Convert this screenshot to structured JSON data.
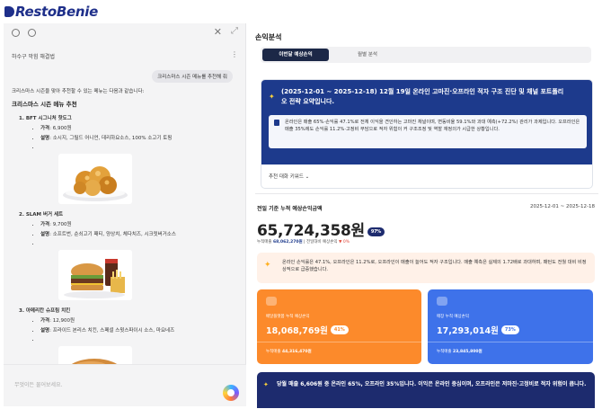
{
  "app": {
    "brand": "RestoBenie"
  },
  "chat": {
    "session_title": "하수구 막힘 해결법",
    "user_message": "크리스마스 시즌 메뉴를 추천해 줘",
    "intro": "크리스마스 시즌을 맞아 추천할 수 있는 메뉴는 다음과 같습니다:",
    "heading": "크리스마스 시즌 메뉴 추천",
    "price_label": "가격",
    "desc_label": "설명",
    "items": [
      {
        "title": "1. BFT 시그니처 핫도그",
        "price": "6,900원",
        "desc": "소시지, 그릴드 어니언, 데리하요소스, 100% 소고기 토핑",
        "image": "fried-chicken-image"
      },
      {
        "title": "2. SLAM 버거 세트",
        "price": "9,700원",
        "desc": "소프트번, 순쇠고기 패티, 양상치, 체다치즈, 시크릿버거소스",
        "image": "burger-set-image"
      },
      {
        "title": "3. 아메리칸 슈프림 치킨",
        "price": "12,900원",
        "desc": "프라이드 본리스 치킨, 스페셜 스윗스파이시 소스, 마요네즈",
        "image": "bun-image"
      }
    ],
    "input_placeholder": "무엇이든 물어보세요."
  },
  "panel": {
    "title": "손익분석",
    "tabs": [
      {
        "label": "이번달 예상손익"
      },
      {
        "label": "월별 분석"
      }
    ],
    "summary": {
      "title": "(2025-12-01 ~ 2025-12-18) 12월 19일 온라인 고마진·오프라인 적자 구조 진단 및 채널 포트폴리오 전략 요약입니다.",
      "body": "온라인은 매출 65%·손익률 47.1%로 전체 이익을 견인하는 고마진 채널이며, 변동비율 59.1%와 과대 예측(+72.2%) 관리가 과제입니다. 오프라인은 매출 35%에도 손익률 11.2%·고정비 부담으로 적자 위험이 커 구조조정 및 역할 재정의가 시급한 상황입니다.",
      "more_label": "추천 대화 키워드"
    },
    "cumulative": {
      "label": "전일 기준 누적 예상손익금액",
      "date_range": "2025-12-01 ~ 2025-12-18",
      "value": "65,724,358원",
      "badge": "97%",
      "sub_label": "누적매출",
      "sub_value": "68,062,270원",
      "sub_compare": "전일대비 예상손익",
      "sub_change": "▼ 0%"
    },
    "insight": "온라인 손익률은 47.1%, 오프라인은 11.2%로, 오프라인이 매출이 늘어도 적자 구조입니다. 매출 예측은 실제의 1.72배로 과대하며, 패턴도 전월 대비 비정상적으로 급증했습니다.",
    "boxes": [
      {
        "label": "배달플랫폼 누적 예상손익",
        "value": "18,068,769원",
        "badge": "41%",
        "foot_label": "누적매출",
        "foot_value": "44,316,470원"
      },
      {
        "label": "매장 누적 예상손익",
        "value": "17,293,014원",
        "badge": "73%",
        "foot_label": "누적매출",
        "foot_value": "23,845,800원"
      }
    ],
    "banner": "당월 매출 6,606원 중 온라인 65%, 오프라인 35%입니다. 이익은 온라인 중심이며, 오프라인은 저마진·고정비로 적자 위험이 큽니다."
  },
  "colors": {
    "brand_navy": "#1e2f8a",
    "orange": "#fc8a2b",
    "blue": "#3e72ea"
  }
}
